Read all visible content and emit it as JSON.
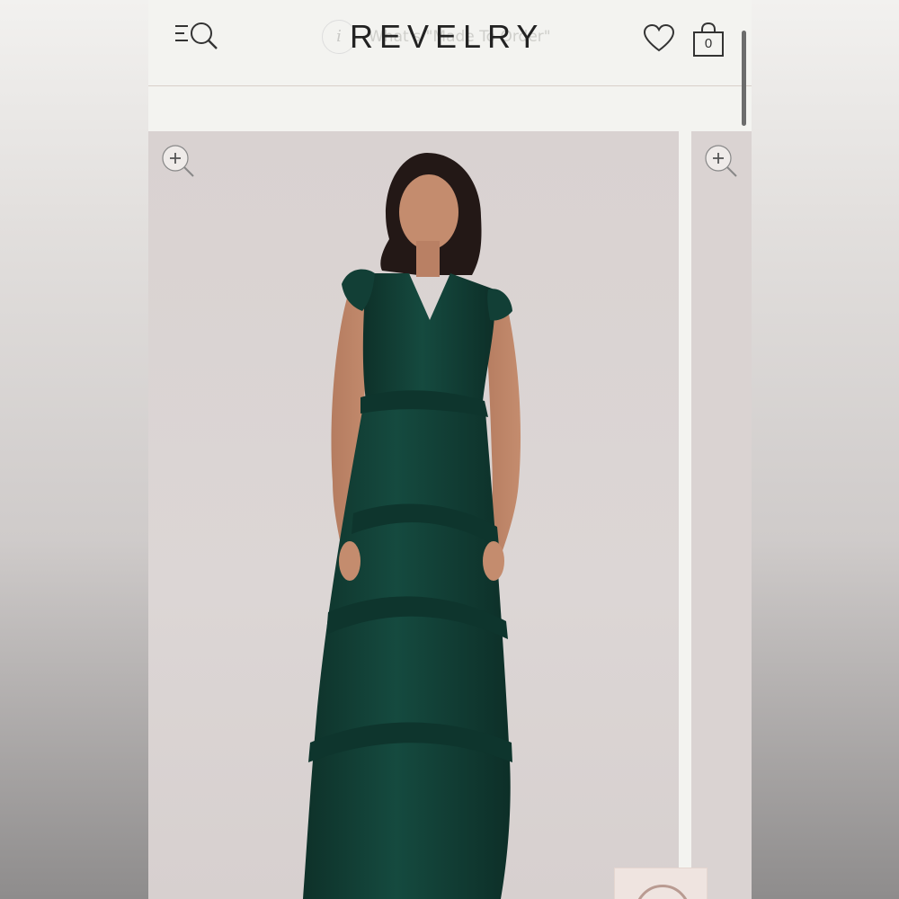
{
  "header": {
    "brand": "REVELRY",
    "search_hint": "What's \"Made To Order\"",
    "search_hint_icon": "i",
    "cart_count": "0"
  },
  "icons": {
    "menu_search": "menu-search-icon",
    "wishlist": "heart-icon",
    "cart": "shopping-bag-icon",
    "zoom": "zoom-in-icon"
  },
  "colors": {
    "dress": "#123f36",
    "background": "#f3f3f0",
    "photo_bg": "#dad3d2"
  }
}
